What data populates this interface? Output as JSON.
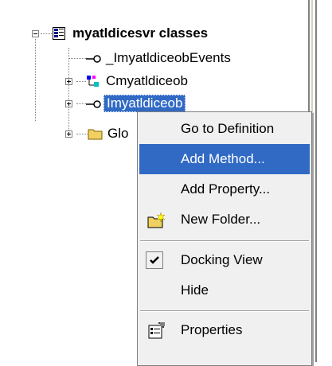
{
  "tree": {
    "root": "myatldicesvr classes",
    "items": [
      {
        "label": "_ImyatldiceobEvents"
      },
      {
        "label": "Cmyatldiceob"
      },
      {
        "label": "Imyatldiceob",
        "selected": true
      },
      {
        "label": "Glo"
      }
    ]
  },
  "menu": {
    "items": [
      {
        "label": "Go to Definition",
        "mnemonic": "G"
      },
      {
        "label": "Add Method...",
        "mnemonic": "M"
      },
      {
        "label": "Add Property...",
        "mnemonic": "P"
      },
      {
        "label": "New Folder...",
        "mnemonic": "w"
      },
      {
        "label": "Docking View",
        "checked": true
      },
      {
        "label": "Hide",
        "mnemonic": "H"
      },
      {
        "label": "Properties",
        "mnemonic": "o"
      }
    ]
  },
  "colors": {
    "highlight": "#316ac5",
    "menu_bg": "#f0f0f0"
  }
}
